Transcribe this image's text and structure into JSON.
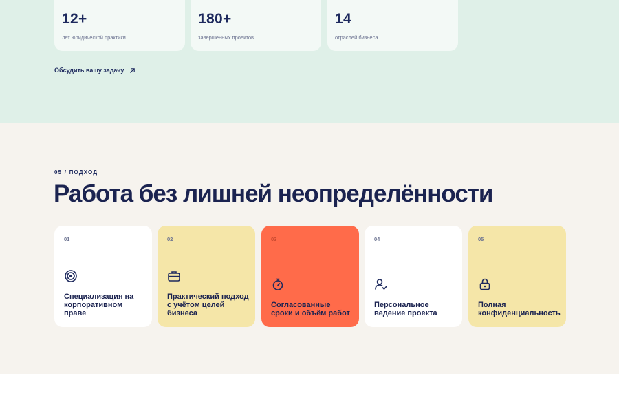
{
  "stats": [
    {
      "value": "12+",
      "label": "лет юридической практики"
    },
    {
      "value": "180+",
      "label": "завершённых проектов"
    },
    {
      "value": "14",
      "label": "отраслей бизнеса"
    }
  ],
  "discuss_link": {
    "label": "Обсудить вашу задачу",
    "icon": "arrow-up-right-icon"
  },
  "approach": {
    "kicker": "05 / ПОДХОД",
    "title": "Работа без лишней неопределённости",
    "cards": [
      {
        "num": "01",
        "icon": "target-icon",
        "text": "Специализация на корпоративном праве",
        "color": "#ffffff"
      },
      {
        "num": "02",
        "icon": "briefcase-icon",
        "text": "Практический подход с учётом целей бизнеса",
        "color": "#f5e6a8"
      },
      {
        "num": "03",
        "icon": "stopwatch-icon",
        "text": "Согласованные сроки и объём работ",
        "color": "#ff6b4a"
      },
      {
        "num": "04",
        "icon": "user-check-icon",
        "text": "Персональное ведение проекта",
        "color": "#ffffff"
      },
      {
        "num": "05",
        "icon": "lock-icon",
        "text": "Полная конфиденциальность",
        "color": "#f5e6a8"
      }
    ]
  },
  "colors": {
    "navy": "#1e2a5e",
    "mint": "#dff0e8",
    "cream": "#f6f3ee",
    "coral": "#ff6b4a",
    "yellow": "#f5e6a8"
  }
}
